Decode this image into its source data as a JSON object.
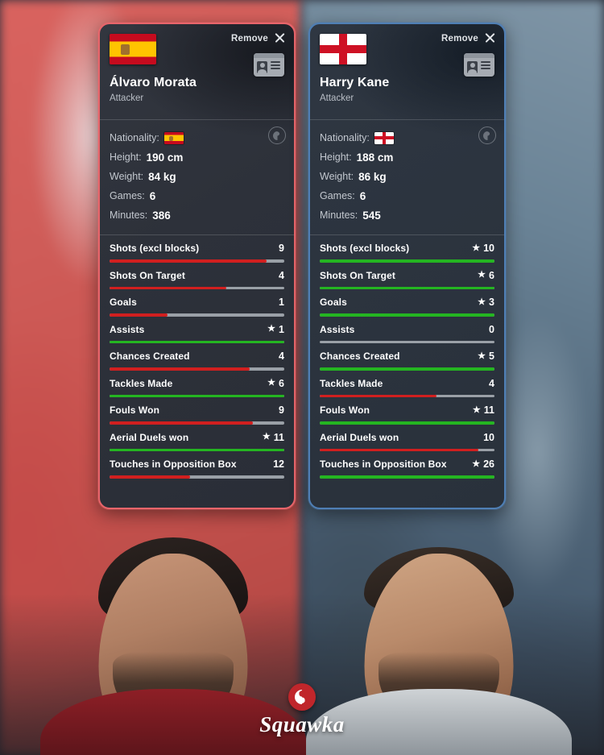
{
  "brand": {
    "name": "Squawka",
    "mark": "squawka-logo-icon",
    "accent": "#c0262b"
  },
  "colors": {
    "bar_better": "#24b521",
    "bar_worse": "#d11f1f",
    "bar_track": "#9aa0a7",
    "border_left": "#e8656b",
    "border_right": "#4f7fb5"
  },
  "players": [
    {
      "name": "Álvaro Morata",
      "position": "Attacker",
      "remove_label": "Remove",
      "flag": "spain-flag-icon",
      "bio": [
        {
          "key": "Nationality:",
          "value": "",
          "flag": "spain-flag-icon"
        },
        {
          "key": "Height:",
          "value": "190 cm"
        },
        {
          "key": "Weight:",
          "value": "84 kg"
        },
        {
          "key": "Games:",
          "value": "6"
        },
        {
          "key": "Minutes:",
          "value": "386"
        }
      ],
      "stats": [
        {
          "label": "Shots (excl blocks)",
          "value": "9",
          "star": false,
          "pct": 90,
          "better": false
        },
        {
          "label": "Shots On Target",
          "value": "4",
          "star": false,
          "pct": 67,
          "better": false
        },
        {
          "label": "Goals",
          "value": "1",
          "star": false,
          "pct": 33,
          "better": false
        },
        {
          "label": "Assists",
          "value": "1",
          "star": true,
          "pct": 100,
          "better": true
        },
        {
          "label": "Chances Created",
          "value": "4",
          "star": false,
          "pct": 80,
          "better": false
        },
        {
          "label": "Tackles Made",
          "value": "6",
          "star": true,
          "pct": 100,
          "better": true
        },
        {
          "label": "Fouls Won",
          "value": "9",
          "star": false,
          "pct": 82,
          "better": false
        },
        {
          "label": "Aerial Duels won",
          "value": "11",
          "star": true,
          "pct": 100,
          "better": true
        },
        {
          "label": "Touches in Opposition Box",
          "value": "12",
          "star": false,
          "pct": 46,
          "better": false
        }
      ]
    },
    {
      "name": "Harry Kane",
      "position": "Attacker",
      "remove_label": "Remove",
      "flag": "england-flag-icon",
      "bio": [
        {
          "key": "Nationality:",
          "value": "",
          "flag": "england-flag-icon"
        },
        {
          "key": "Height:",
          "value": "188 cm"
        },
        {
          "key": "Weight:",
          "value": "86 kg"
        },
        {
          "key": "Games:",
          "value": "6"
        },
        {
          "key": "Minutes:",
          "value": "545"
        }
      ],
      "stats": [
        {
          "label": "Shots (excl blocks)",
          "value": "10",
          "star": true,
          "pct": 100,
          "better": true
        },
        {
          "label": "Shots On Target",
          "value": "6",
          "star": true,
          "pct": 100,
          "better": true
        },
        {
          "label": "Goals",
          "value": "3",
          "star": true,
          "pct": 100,
          "better": true
        },
        {
          "label": "Assists",
          "value": "0",
          "star": false,
          "pct": 0,
          "better": false
        },
        {
          "label": "Chances Created",
          "value": "5",
          "star": true,
          "pct": 100,
          "better": true
        },
        {
          "label": "Tackles Made",
          "value": "4",
          "star": false,
          "pct": 67,
          "better": false
        },
        {
          "label": "Fouls Won",
          "value": "11",
          "star": true,
          "pct": 100,
          "better": true
        },
        {
          "label": "Aerial Duels won",
          "value": "10",
          "star": false,
          "pct": 91,
          "better": false
        },
        {
          "label": "Touches in Opposition Box",
          "value": "26",
          "star": true,
          "pct": 100,
          "better": true
        }
      ]
    }
  ]
}
